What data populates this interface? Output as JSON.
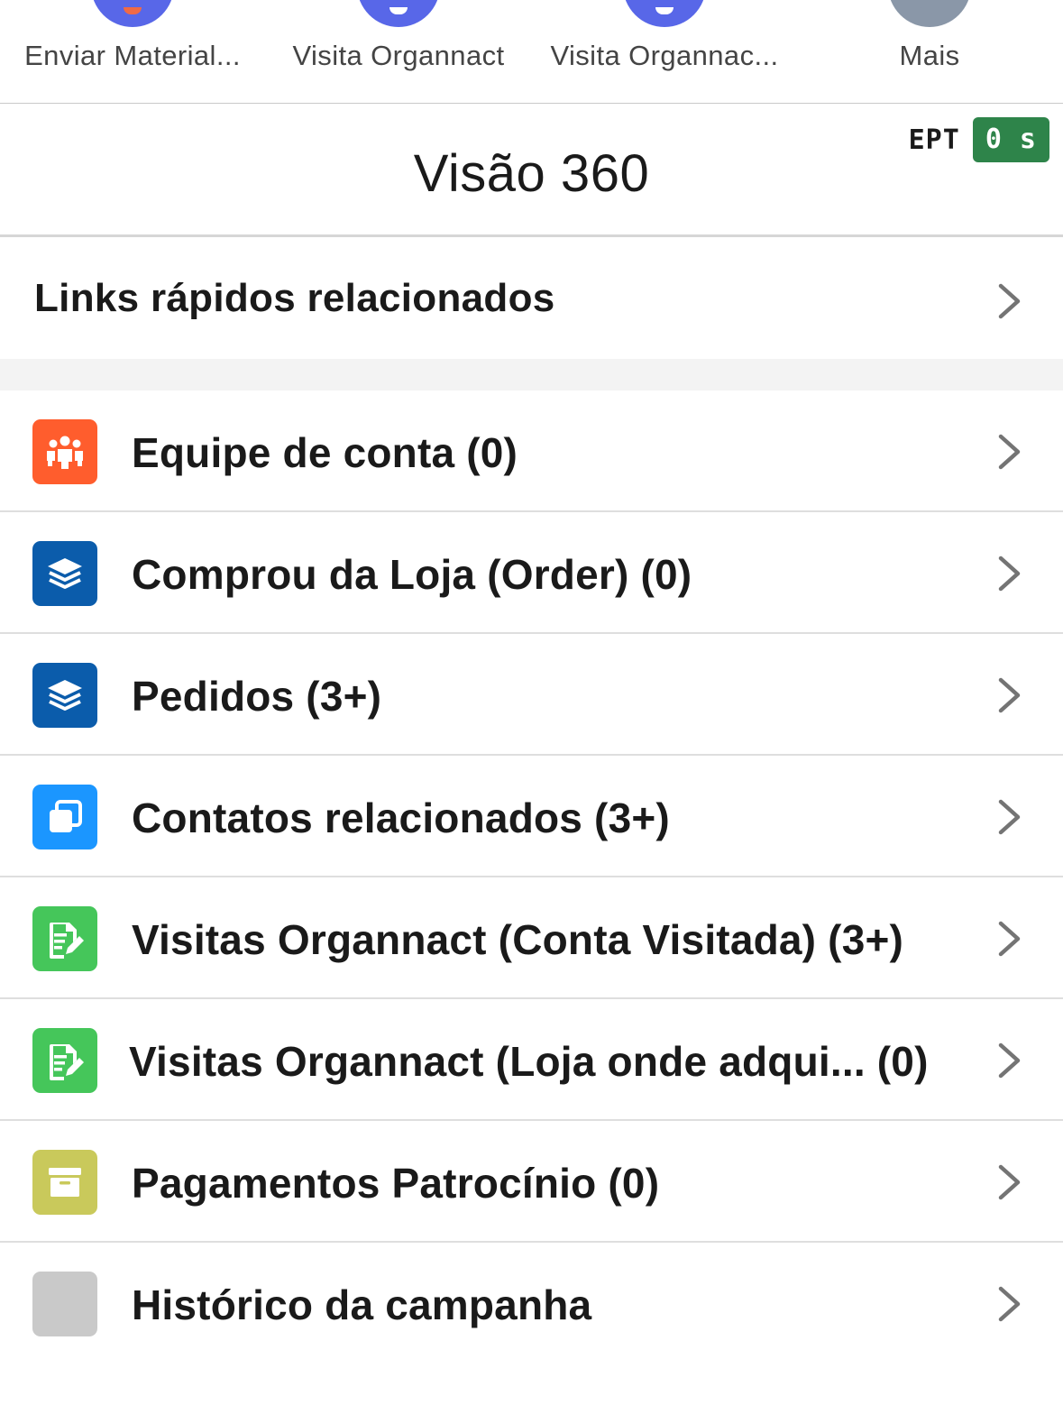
{
  "action_bar": {
    "actions": [
      {
        "label": "Enviar Material...",
        "icon": "send-material-icon",
        "color": "#5867e8",
        "accent": "#f06a46"
      },
      {
        "label": "Visita Organnact",
        "icon": "visit-icon",
        "color": "#5867e8",
        "accent": "#ffffff"
      },
      {
        "label": "Visita Organnac...",
        "icon": "visit-icon",
        "color": "#5867e8",
        "accent": "#ffffff"
      },
      {
        "label": "Mais",
        "icon": "more-icon",
        "color": "#8a97a8",
        "accent": "#8a97a8"
      }
    ]
  },
  "header": {
    "title": "Visão 360",
    "ept_label": "EPT",
    "ept_value": "0 s",
    "ept_color": "#2e844a"
  },
  "quick_links": {
    "label": "Links rápidos relacionados"
  },
  "related_lists": [
    {
      "label": "Equipe de conta (0)",
      "icon": "team-icon",
      "color": "#ff5d2d"
    },
    {
      "label": "Comprou da Loja (Order) (0)",
      "icon": "layers-icon",
      "color": "#0b5cab"
    },
    {
      "label": "Pedidos (3+)",
      "icon": "layers-icon",
      "color": "#0b5cab"
    },
    {
      "label": "Contatos relacionados (3+)",
      "icon": "contacts-icon",
      "color": "#1b96ff"
    },
    {
      "label": "Visitas Organnact (Conta Visitada) (3+)",
      "icon": "visit-form-icon",
      "color": "#45c65a"
    },
    {
      "label": "Visitas Organnact (Loja onde adqui... (0)",
      "icon": "visit-form-icon",
      "color": "#45c65a"
    },
    {
      "label": "Pagamentos Patrocínio (0)",
      "icon": "archive-icon",
      "color": "#c9c95b"
    },
    {
      "label": "Histórico da campanha",
      "icon": "blank-icon",
      "color": "#c9c9c9"
    }
  ]
}
